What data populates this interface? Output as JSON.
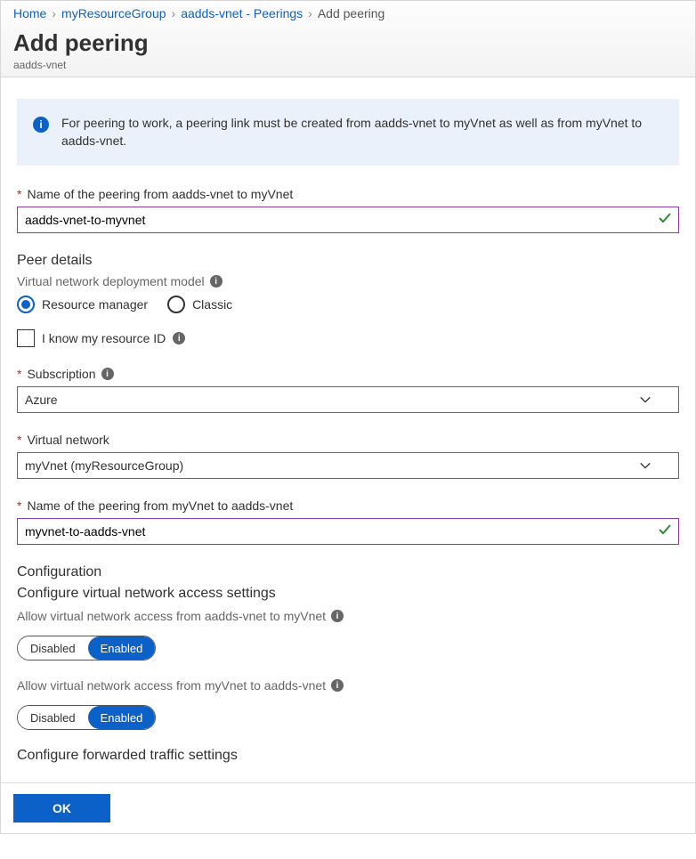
{
  "breadcrumb": {
    "home": "Home",
    "group": "myResourceGroup",
    "vnet": "aadds-vnet - Peerings",
    "current": "Add peering"
  },
  "title": "Add peering",
  "subtitle": "aadds-vnet",
  "info": "For peering to work, a peering link must be created from aadds-vnet to myVnet as well as from myVnet to aadds-vnet.",
  "fields": {
    "name1_label": "Name of the peering from aadds-vnet to myVnet",
    "name1_value": "aadds-vnet-to-myvnet",
    "peer_details_h": "Peer details",
    "deploy_model_label": "Virtual network deployment model",
    "radio_rm": "Resource manager",
    "radio_classic": "Classic",
    "know_id": "I know my resource ID",
    "subscription_label": "Subscription",
    "subscription_value": "Azure",
    "vnet_label": "Virtual network",
    "vnet_value": "myVnet (myResourceGroup)",
    "name2_label": "Name of the peering from myVnet to aadds-vnet",
    "name2_value": "myvnet-to-aadds-vnet",
    "config_h": "Configuration",
    "config_access_h": "Configure virtual network access settings",
    "allow1_label": "Allow virtual network access from aadds-vnet to myVnet",
    "allow2_label": "Allow virtual network access from myVnet to aadds-vnet",
    "toggle_disabled": "Disabled",
    "toggle_enabled": "Enabled",
    "forwarded_h": "Configure forwarded traffic settings"
  },
  "footer": {
    "ok": "OK"
  }
}
